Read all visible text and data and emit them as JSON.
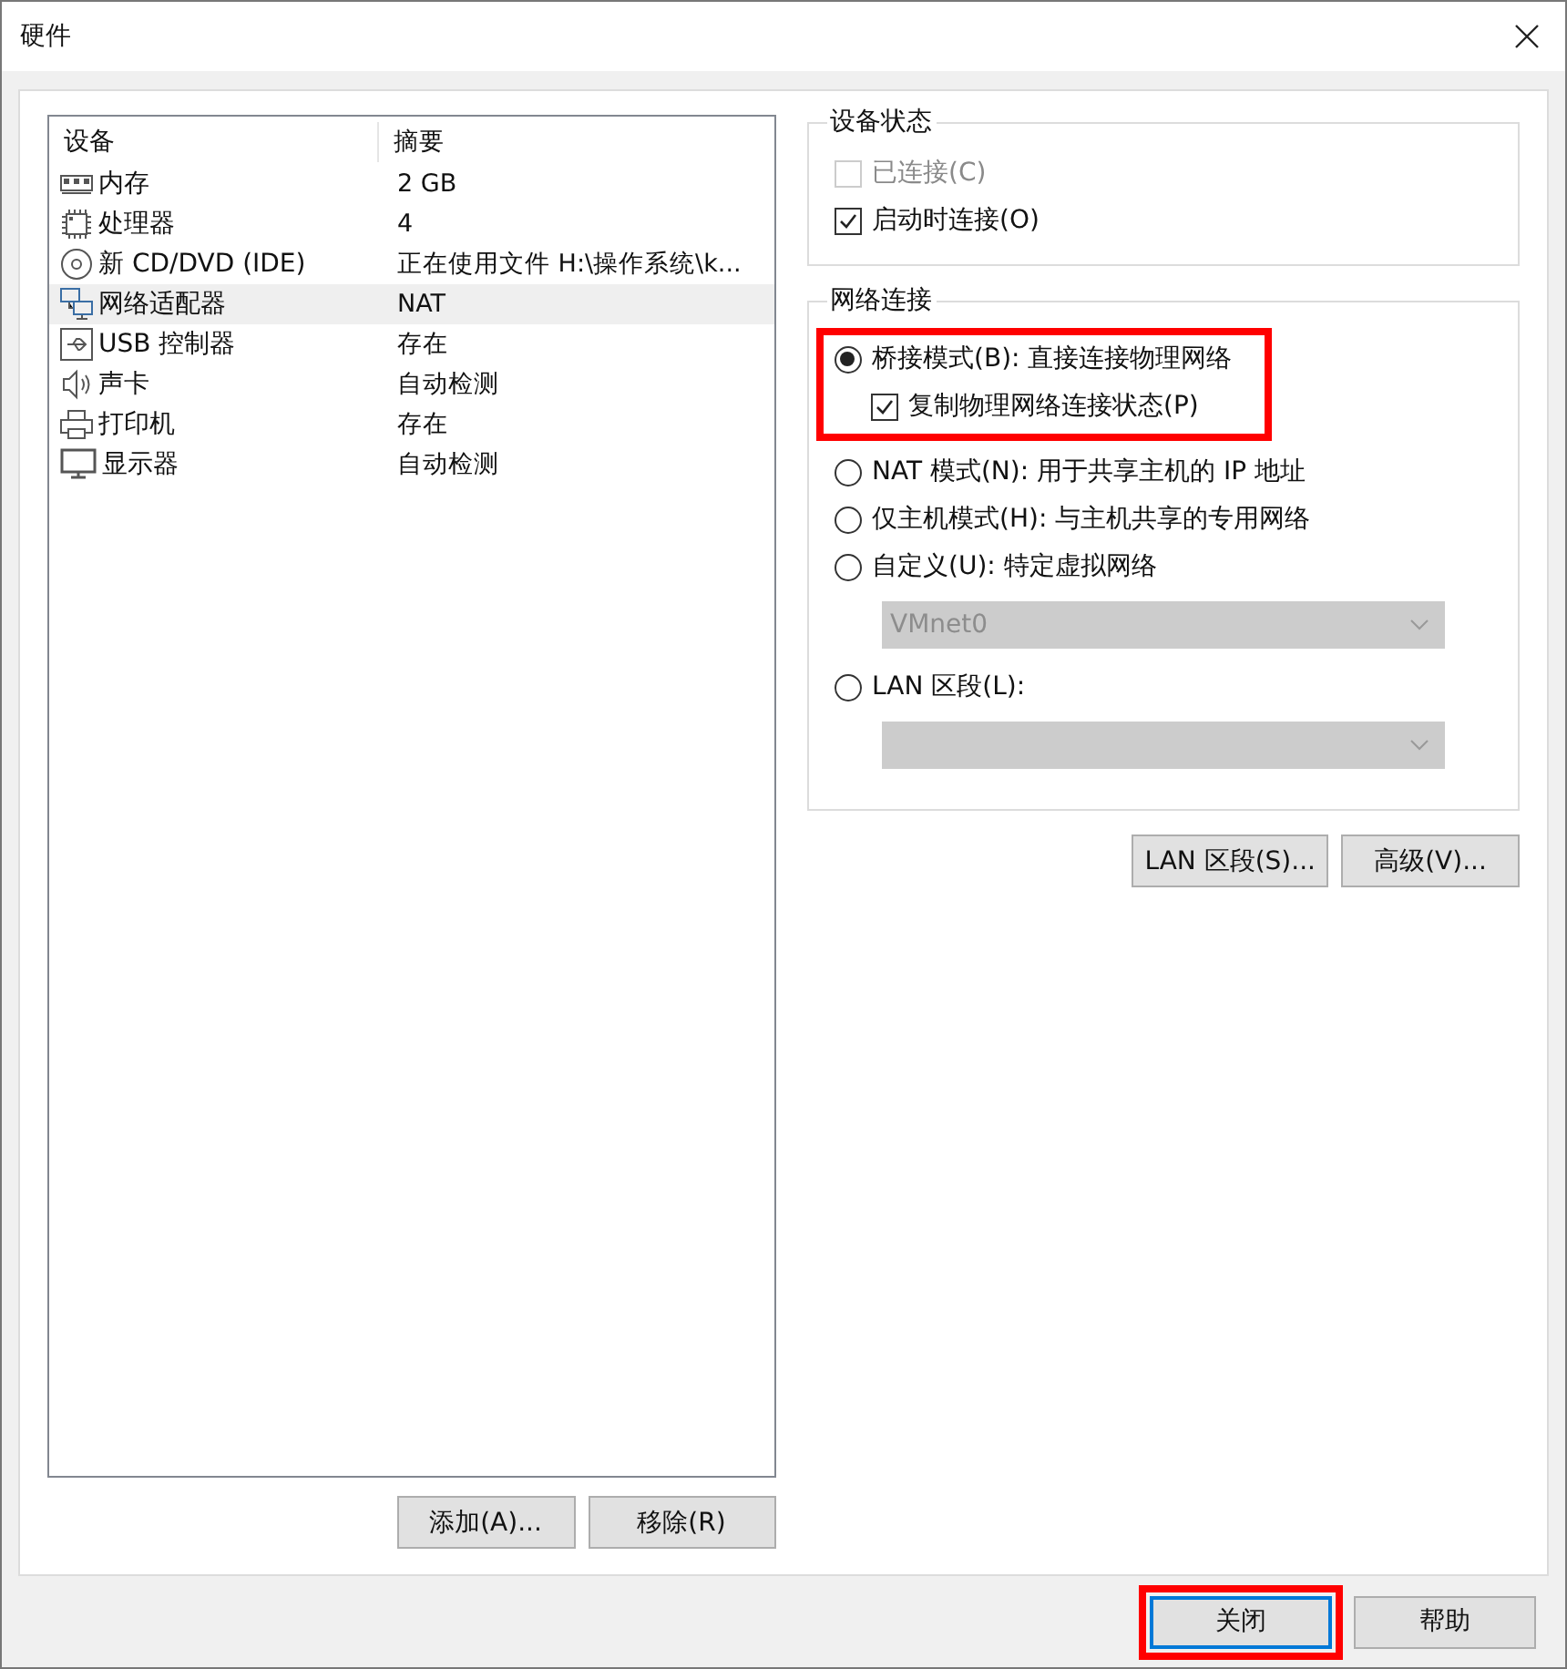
{
  "window": {
    "title": "硬件"
  },
  "device_list": {
    "columns": [
      "设备",
      "摘要"
    ],
    "rows": [
      {
        "kind": "memory",
        "name": "内存",
        "summary": "2 GB",
        "selected": false
      },
      {
        "kind": "cpu",
        "name": "处理器",
        "summary": "4",
        "selected": false
      },
      {
        "kind": "disc",
        "name": "新 CD/DVD (IDE)",
        "summary": "正在使用文件 H:\\操作系统\\k...",
        "selected": false
      },
      {
        "kind": "network",
        "name": "网络适配器",
        "summary": "NAT",
        "selected": true
      },
      {
        "kind": "usb",
        "name": "USB 控制器",
        "summary": "存在",
        "selected": false
      },
      {
        "kind": "sound",
        "name": "声卡",
        "summary": "自动检测",
        "selected": false
      },
      {
        "kind": "printer",
        "name": "打印机",
        "summary": "存在",
        "selected": false
      },
      {
        "kind": "monitor",
        "name": "显示器",
        "summary": "自动检测",
        "selected": false
      }
    ]
  },
  "list_buttons": [
    "添加(A)...",
    "移除(R)"
  ],
  "device_status": {
    "title": "设备状态",
    "checkboxes": [
      {
        "label": "已连接(C)",
        "checked": false,
        "disabled": true
      },
      {
        "label": "启动时连接(O)",
        "checked": true,
        "disabled": false
      }
    ]
  },
  "network_connection": {
    "title": "网络连接",
    "options": [
      {
        "label": "桥接模式(B): 直接连接物理网络",
        "selected": true,
        "highlighted": true,
        "sub_checkbox": {
          "label": "复制物理网络连接状态(P)",
          "checked": true
        }
      },
      {
        "label": "NAT 模式(N): 用于共享主机的 IP 地址",
        "selected": false,
        "highlighted": false
      },
      {
        "label": "仅主机模式(H): 与主机共享的专用网络",
        "selected": false,
        "highlighted": false
      },
      {
        "label": "自定义(U): 特定虚拟网络",
        "selected": false,
        "highlighted": false,
        "dropdown": {
          "value": "VMnet0",
          "disabled": true
        }
      },
      {
        "label": "LAN 区段(L):",
        "selected": false,
        "highlighted": false,
        "dropdown": {
          "disabled": true
        }
      }
    ]
  },
  "network_buttons": [
    "LAN 区段(S)...",
    "高级(V)..."
  ],
  "footer_buttons": [
    {
      "label": "关闭",
      "focused": true,
      "highlighted": true
    },
    {
      "label": "帮助",
      "focused": false,
      "highlighted": false
    }
  ]
}
